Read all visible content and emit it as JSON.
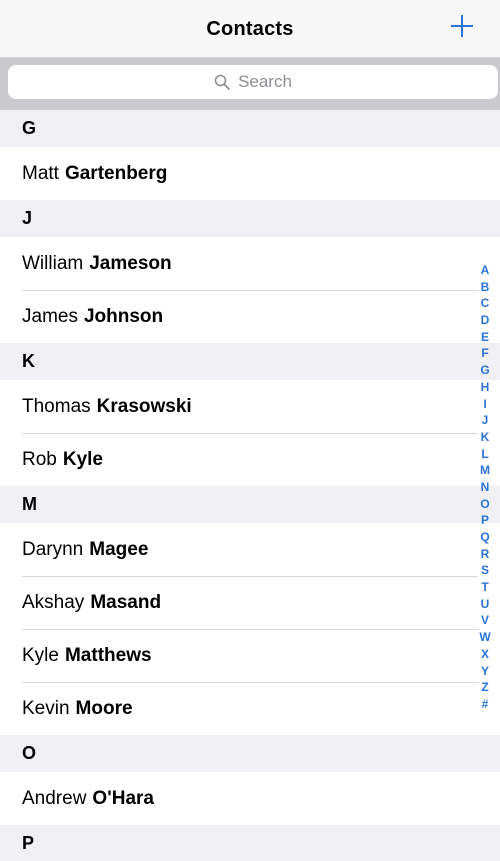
{
  "nav": {
    "title": "Contacts",
    "add_icon": "plus-icon",
    "accent": "#2b73d9"
  },
  "search": {
    "placeholder": "Search",
    "icon": "search-icon"
  },
  "sections": [
    {
      "letter": "G",
      "contacts": [
        {
          "first": "Matt",
          "last": "Gartenberg"
        }
      ]
    },
    {
      "letter": "J",
      "contacts": [
        {
          "first": "William",
          "last": "Jameson"
        },
        {
          "first": "James",
          "last": "Johnson"
        }
      ]
    },
    {
      "letter": "K",
      "contacts": [
        {
          "first": "Thomas",
          "last": "Krasowski"
        },
        {
          "first": "Rob",
          "last": "Kyle"
        }
      ]
    },
    {
      "letter": "M",
      "contacts": [
        {
          "first": "Darynn",
          "last": "Magee"
        },
        {
          "first": "Akshay",
          "last": "Masand"
        },
        {
          "first": "Kyle",
          "last": "Matthews"
        },
        {
          "first": "Kevin",
          "last": "Moore"
        }
      ]
    },
    {
      "letter": "O",
      "contacts": [
        {
          "first": "Andrew",
          "last": "O'Hara"
        }
      ]
    },
    {
      "letter": "P",
      "contacts": []
    }
  ],
  "index_letters": [
    "A",
    "B",
    "C",
    "D",
    "E",
    "F",
    "G",
    "H",
    "I",
    "J",
    "K",
    "L",
    "M",
    "N",
    "O",
    "P",
    "Q",
    "R",
    "S",
    "T",
    "U",
    "V",
    "W",
    "X",
    "Y",
    "Z",
    "#"
  ]
}
